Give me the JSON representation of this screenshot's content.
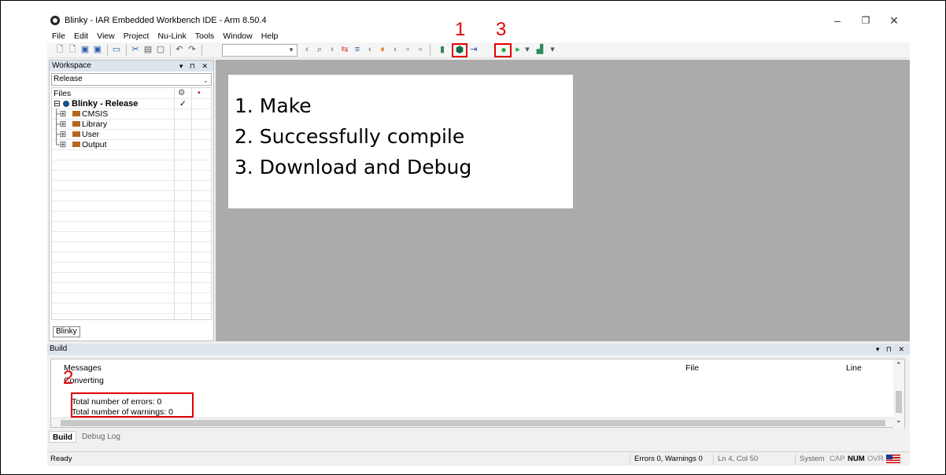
{
  "window": {
    "title": "Blinky - IAR Embedded Workbench IDE - Arm 8.50.4",
    "controls": [
      "–",
      "❐",
      "✕"
    ]
  },
  "menu": [
    "File",
    "Edit",
    "View",
    "Project",
    "Nu-Link",
    "Tools",
    "Window",
    "Help"
  ],
  "toolbar": {
    "marker_make": "1",
    "marker_debug": "3",
    "make_icon": "make-icon",
    "debug_icon": "download-and-debug-icon"
  },
  "workspace": {
    "title": "Workspace",
    "controls": "▾ ⊓ ✕",
    "config": "Release",
    "files_header": "Files",
    "gear_header": "⚙",
    "dot_header": "•",
    "project": "Blinky - Release",
    "project_check": "✓",
    "folders": [
      "CMSIS",
      "Library",
      "User",
      "Output"
    ],
    "tab": "Blinky"
  },
  "callout": {
    "line1": "1. Make",
    "line2": "2. Successfully compile",
    "line3": "3. Download and Debug"
  },
  "build": {
    "title": "Build",
    "controls": "▾ ⊓ ✕",
    "col_messages": "Messages",
    "col_file": "File",
    "col_line": "Line",
    "marker": "2",
    "messages": [
      "Converting",
      "Total number of errors: 0",
      "Total number of warnings: 0"
    ],
    "tabs": [
      "Build",
      "Debug Log"
    ]
  },
  "statusbar": {
    "status": "Ready",
    "errors": "Errors 0, Warnings 0",
    "position": "Ln 4, Col 50",
    "system": "System",
    "cap": "CAP",
    "num": "NUM",
    "ovr": "OVR"
  },
  "colors": {
    "marker_red": "#e00000",
    "editor_bg": "#ababab",
    "pane_header": "#dde4ec"
  }
}
